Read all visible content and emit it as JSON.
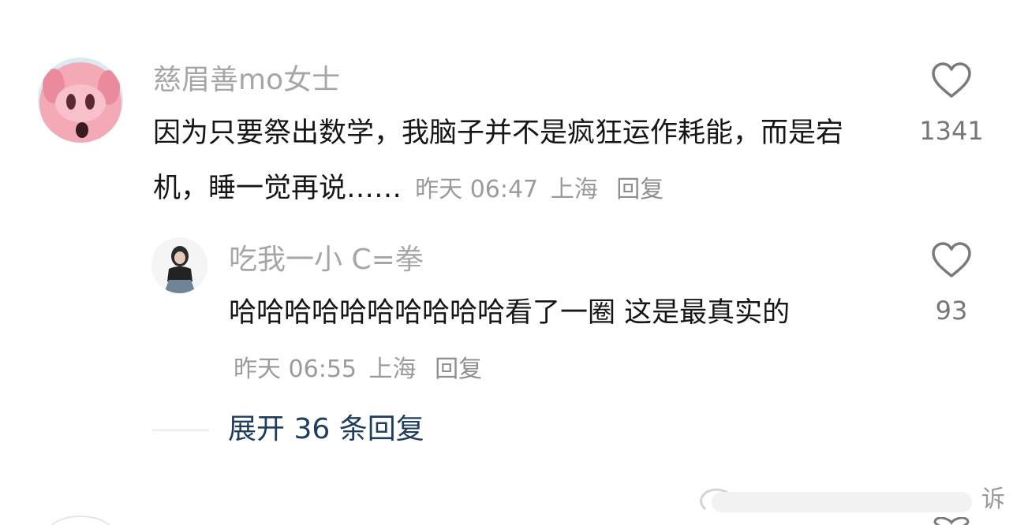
{
  "comment": {
    "username": "慈眉善mo女士",
    "text": "因为只要祭出数学，我脑子并不是疯狂运作耗能，而是宕机，睡一觉再说……",
    "time": "昨天 06:47",
    "location": "上海",
    "reply_label": "回复",
    "like_count": "1341",
    "like_icon": "heart-outline-icon"
  },
  "reply": {
    "username": "吃我一小 C=拳",
    "text": "哈哈哈哈哈哈哈哈哈哈看了一圈  这是最真实的",
    "time": "昨天 06:55",
    "location": "上海",
    "reply_label": "回复",
    "like_count": "93",
    "like_icon": "heart-outline-icon"
  },
  "expand_replies": "展开 36 条回复",
  "watermark_text": "诉",
  "colors": {
    "username": "#a6a6a6",
    "text": "#161616",
    "meta": "#9b9b9b",
    "expand_link": "#1f3d5c",
    "like_count": "#767676"
  }
}
